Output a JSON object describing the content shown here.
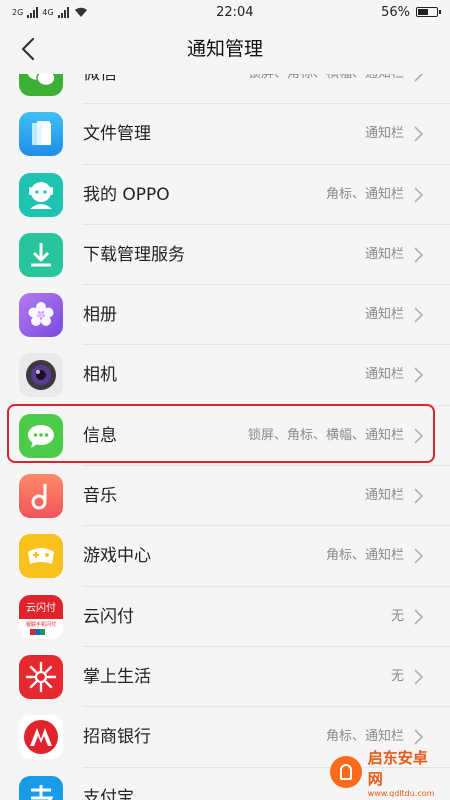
{
  "status_bar": {
    "signal_1": "2G",
    "signal_2": "4G",
    "time": "22:04",
    "battery": "56%",
    "battery_level": 0.56
  },
  "header": {
    "title": "通知管理"
  },
  "apps": [
    {
      "name": "微信",
      "value": "锁屏、角标、横幅、通知栏",
      "icon": "wechat-icon"
    },
    {
      "name": "文件管理",
      "value": "通知栏",
      "icon": "file-manager-icon"
    },
    {
      "name": "我的 OPPO",
      "value": "角标、通知栏",
      "icon": "my-oppo-icon"
    },
    {
      "name": "下载管理服务",
      "value": "通知栏",
      "icon": "download-icon"
    },
    {
      "name": "相册",
      "value": "通知栏",
      "icon": "gallery-icon"
    },
    {
      "name": "相机",
      "value": "通知栏",
      "icon": "camera-icon"
    },
    {
      "name": "信息",
      "value": "锁屏、角标、横幅、通知栏",
      "icon": "messages-icon"
    },
    {
      "name": "音乐",
      "value": "通知栏",
      "icon": "music-icon"
    },
    {
      "name": "游戏中心",
      "value": "角标、通知栏",
      "icon": "game-center-icon"
    },
    {
      "name": "云闪付",
      "value": "无",
      "icon": "unionpay-icon"
    },
    {
      "name": "掌上生活",
      "value": "无",
      "icon": "life-icon"
    },
    {
      "name": "招商银行",
      "value": "角标、通知栏",
      "icon": "cmb-icon"
    },
    {
      "name": "支付宝",
      "value": "",
      "icon": "alipay-icon"
    }
  ],
  "icon_texts": {
    "unionpay_title": "云闪付",
    "unionpay_sub": "银联手机闪付"
  },
  "watermark": {
    "main": "启东安卓网",
    "sub": "www.qdltdu.com"
  },
  "colors": {
    "highlight": "#d9232e",
    "secondary_text": "#8a8a8a"
  }
}
